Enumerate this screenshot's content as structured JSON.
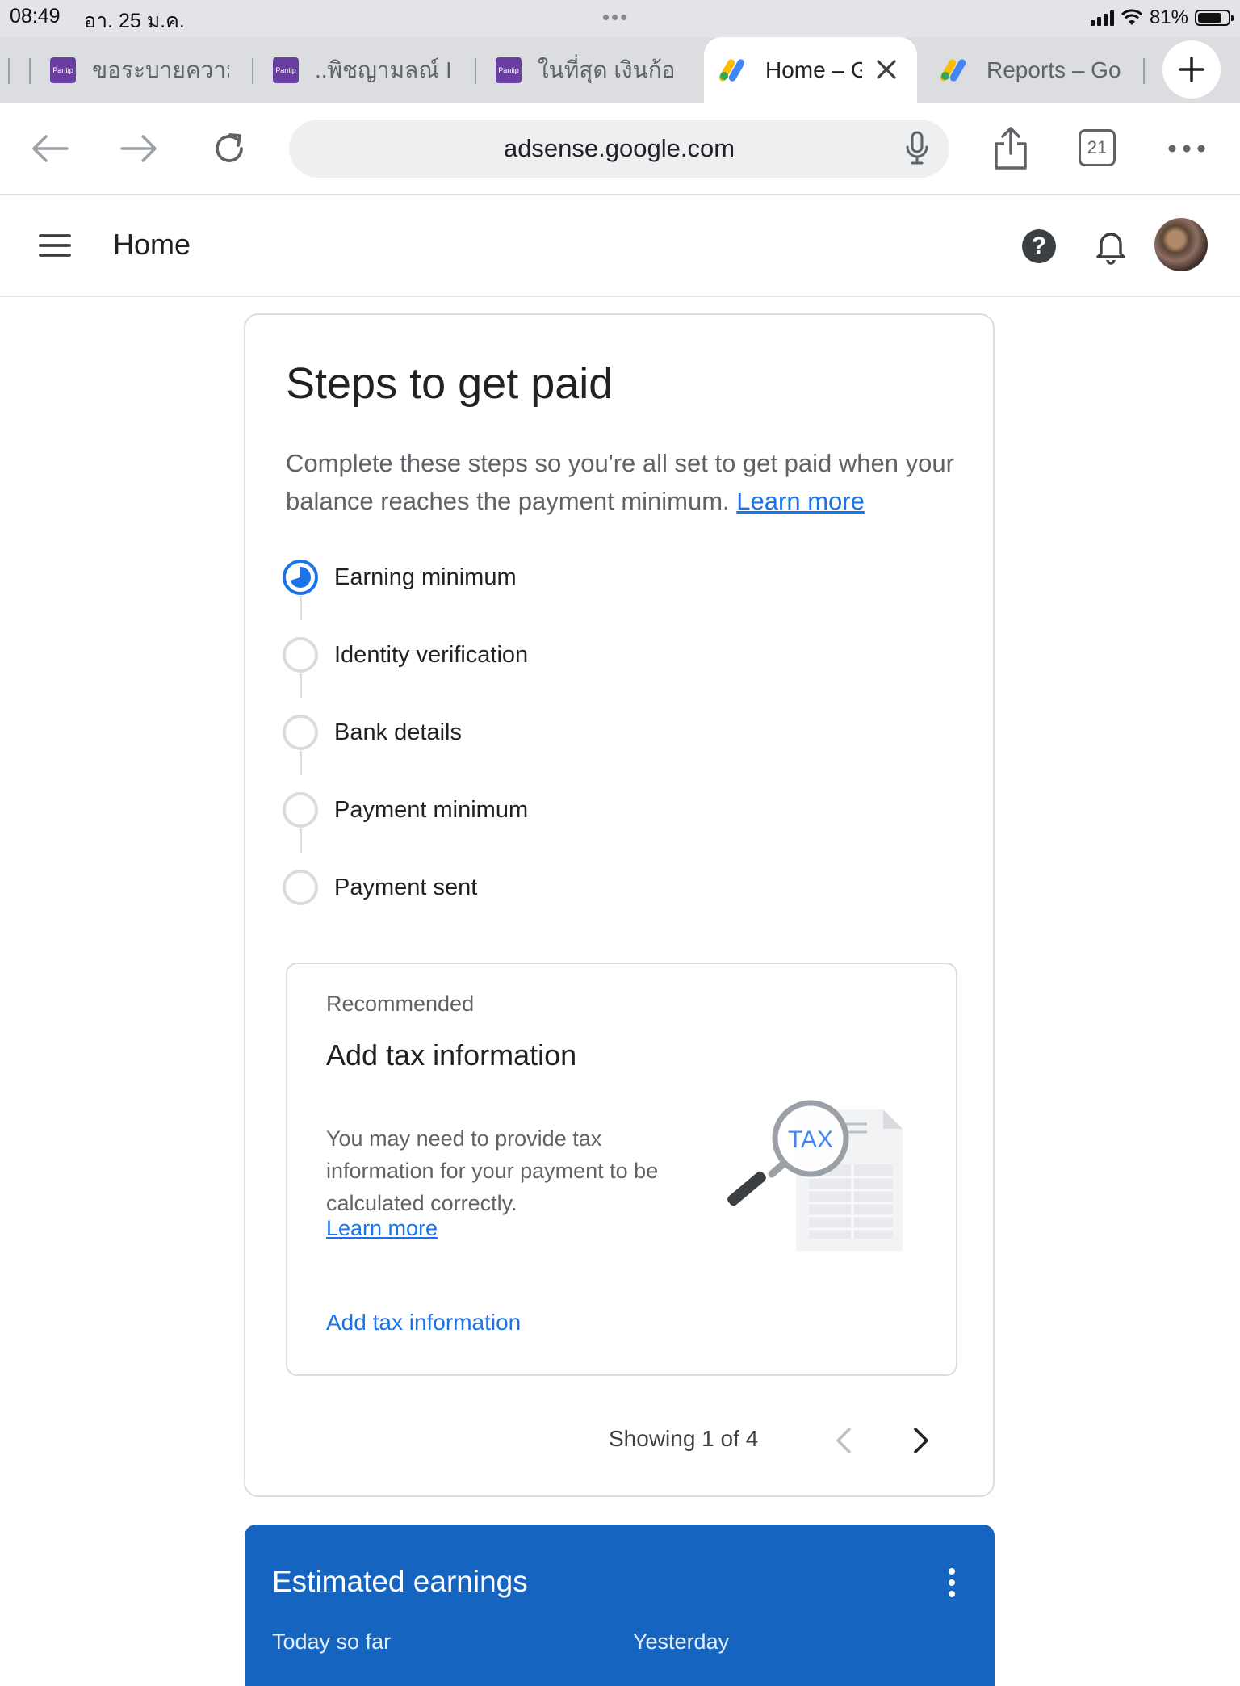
{
  "status_bar": {
    "time": "08:49",
    "date": "อา. 25 ม.ค.",
    "battery": "81%",
    "battery_level": 0.81
  },
  "tabs": [
    {
      "title": "ขอระบายความ",
      "favicon": "pantip-icon",
      "active": false
    },
    {
      "title": "..พิชญามลณ์ I.",
      "favicon": "pantip-icon",
      "active": false
    },
    {
      "title": "ในที่สุด เงินก้อน",
      "favicon": "pantip-icon",
      "active": false
    },
    {
      "title": "Home – G",
      "favicon": "adsense-icon",
      "active": true
    },
    {
      "title": "Reports – Go",
      "favicon": "adsense-icon",
      "active": false
    }
  ],
  "favicon_text": "Pantip",
  "toolbar": {
    "url": "adsense.google.com",
    "tab_count": "21"
  },
  "app_header": {
    "title": "Home"
  },
  "steps_card": {
    "title": "Steps to get paid",
    "intro": "Complete these steps so you're all set to get paid when your balance reaches the payment minimum.",
    "intro_link": "Learn more",
    "steps": [
      {
        "label": "Earning minimum",
        "state": "in-progress"
      },
      {
        "label": "Identity verification",
        "state": "pending"
      },
      {
        "label": "Bank details",
        "state": "pending"
      },
      {
        "label": "Payment minimum",
        "state": "pending"
      },
      {
        "label": "Payment sent",
        "state": "pending"
      }
    ],
    "recommendation": {
      "kicker": "Recommended",
      "title": "Add tax information",
      "body": "You may need to provide tax information for your payment to be calculated correctly.",
      "link": "Learn more",
      "action": "Add tax information",
      "illustration_text": "TAX"
    },
    "pager": {
      "text": "Showing 1 of 4"
    }
  },
  "earnings_card": {
    "title": "Estimated earnings",
    "col1": "Today so far",
    "col2": "Yesterday"
  },
  "colors": {
    "accent": "#1a73e8",
    "earnings_bg": "#1565c0",
    "border": "#dadce0"
  }
}
